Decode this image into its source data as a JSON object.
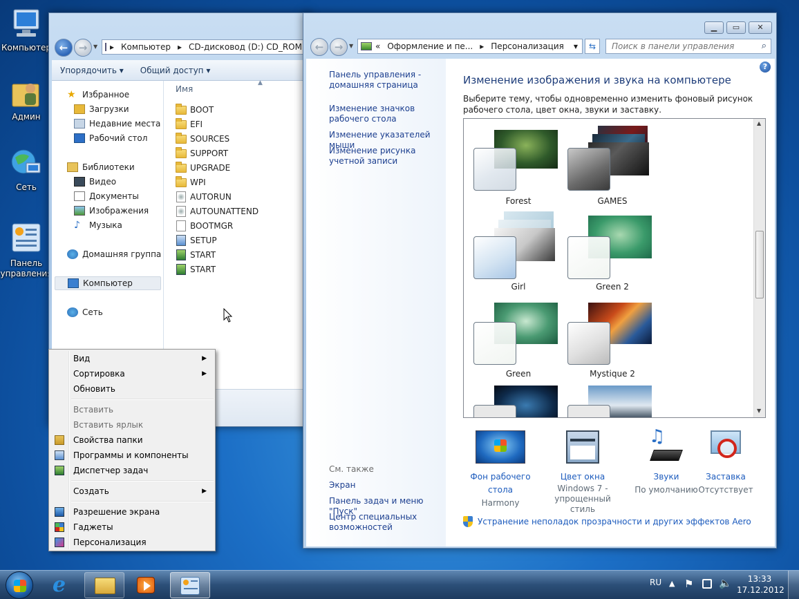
{
  "desktop": {
    "icons": [
      {
        "label": "Компьютер"
      },
      {
        "label": "Админ"
      },
      {
        "label": "Сеть"
      },
      {
        "label": "Панель управления"
      }
    ]
  },
  "explorer": {
    "address": {
      "seg1": "Компьютер",
      "seg2": "CD-дисковод (D:) CD_ROM"
    },
    "commands": {
      "organize": "Упорядочить",
      "share": "Общий доступ"
    },
    "column_name": "Имя",
    "nav": {
      "favorites": "Избранное",
      "downloads": "Загрузки",
      "recent": "Недавние места",
      "desktop": "Рабочий стол",
      "libraries": "Библиотеки",
      "video": "Видео",
      "documents": "Документы",
      "pictures": "Изображения",
      "music": "Музыка",
      "homegroup": "Домашняя группа",
      "computer": "Компьютер",
      "network": "Сеть"
    },
    "files": [
      {
        "name": "BOOT",
        "kind": "folder"
      },
      {
        "name": "EFI",
        "kind": "folder"
      },
      {
        "name": "SOURCES",
        "kind": "folder"
      },
      {
        "name": "SUPPORT",
        "kind": "folder"
      },
      {
        "name": "UPGRADE",
        "kind": "folder"
      },
      {
        "name": "WPI",
        "kind": "folder"
      },
      {
        "name": "AUTORUN",
        "kind": "settings"
      },
      {
        "name": "AUTOUNATTEND",
        "kind": "settings"
      },
      {
        "name": "BOOTMGR",
        "kind": "file"
      },
      {
        "name": "SETUP",
        "kind": "setup"
      },
      {
        "name": "START",
        "kind": "app"
      },
      {
        "name": "START",
        "kind": "app"
      }
    ]
  },
  "control_panel": {
    "breadcrumb": {
      "prefix": "«",
      "seg1": "Оформление и пе...",
      "seg2": "Персонализация"
    },
    "search_placeholder": "Поиск в панели управления",
    "sidebar": {
      "home": "Панель управления - домашняя страница",
      "links": [
        "Изменение значков рабочего стола",
        "Изменение указателей мыши",
        "Изменение рисунка учетной записи"
      ],
      "see_also": "См. также",
      "see_links": [
        "Экран",
        "Панель задач и меню \"Пуск\"",
        "Центр специальных возможностей"
      ]
    },
    "title": "Изменение изображения и звука на компьютере",
    "description": "Выберите тему, чтобы одновременно изменить фоновый рисунок рабочего стола, цвет окна, звуки и заставку.",
    "themes": [
      "Forest",
      "GAMES",
      "Girl",
      "Green 2",
      "Green",
      "Mystique 2"
    ],
    "bottom": [
      {
        "link": "Фон рабочего стола",
        "sub": "Harmony"
      },
      {
        "link": "Цвет окна",
        "sub": "Windows 7 - упрощенный стиль"
      },
      {
        "link": "Звуки",
        "sub": "По умолчанию"
      },
      {
        "link": "Заставка",
        "sub": "Отсутствует"
      }
    ],
    "troubleshoot": "Устранение неполадок прозрачности и других эффектов Aero"
  },
  "context_menu": {
    "view": "Вид",
    "sort": "Сортировка",
    "refresh": "Обновить",
    "paste": "Вставить",
    "paste_shortcut": "Вставить ярлык",
    "folder_options": "Свойства папки",
    "programs": "Программы и компоненты",
    "task_manager": "Диспетчер задач",
    "create": "Создать",
    "resolution": "Разрешение экрана",
    "gadgets": "Гаджеты",
    "personalize": "Персонализация"
  },
  "taskbar": {
    "lang": "RU",
    "time": "13:33",
    "date": "17.12.2012"
  }
}
